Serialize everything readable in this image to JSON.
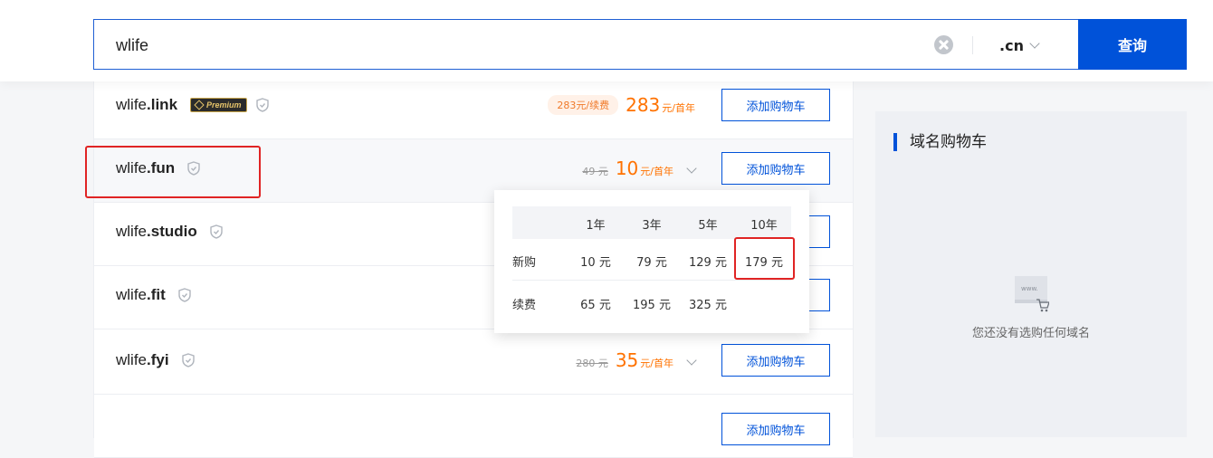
{
  "search": {
    "query": "wlife",
    "tld": ".cn",
    "button_label": "查询"
  },
  "results": [
    {
      "name": "wlife",
      "tld": ".link",
      "premium": true,
      "premium_label": "Premium",
      "renew_tag": "283元/续费",
      "orig_price": "",
      "price": "283",
      "unit": "元/首年",
      "has_dropdown": false,
      "button": "添加购物车"
    },
    {
      "name": "wlife",
      "tld": ".fun",
      "premium": false,
      "renew_tag": "",
      "orig_price": "49 元",
      "price": "10",
      "unit": "元/首年",
      "has_dropdown": true,
      "button": "添加购物车"
    },
    {
      "name": "wlife",
      "tld": ".studio",
      "premium": false,
      "button": "添加购物车"
    },
    {
      "name": "wlife",
      "tld": ".fit",
      "premium": false,
      "button": "添加购物车"
    },
    {
      "name": "wlife",
      "tld": ".fyi",
      "premium": false,
      "renew_tag": "",
      "orig_price": "280 元",
      "price": "35",
      "unit": "元/首年",
      "has_dropdown": true,
      "button": "添加购物车"
    }
  ],
  "price_popup": {
    "headers": [
      "1年",
      "3年",
      "5年",
      "10年"
    ],
    "rows": [
      {
        "label": "新购",
        "values": [
          "10 元",
          "79 元",
          "129 元",
          "179 元"
        ]
      },
      {
        "label": "续费",
        "values": [
          "65 元",
          "195 元",
          "325 元",
          ""
        ]
      }
    ]
  },
  "cart": {
    "title": "域名购物车",
    "empty_text": "您还没有选购任何域名",
    "icon_text": "www."
  },
  "colors": {
    "brand_blue": "#0052d9",
    "price_orange": "#ff7200",
    "annotation_red": "#e02424"
  }
}
